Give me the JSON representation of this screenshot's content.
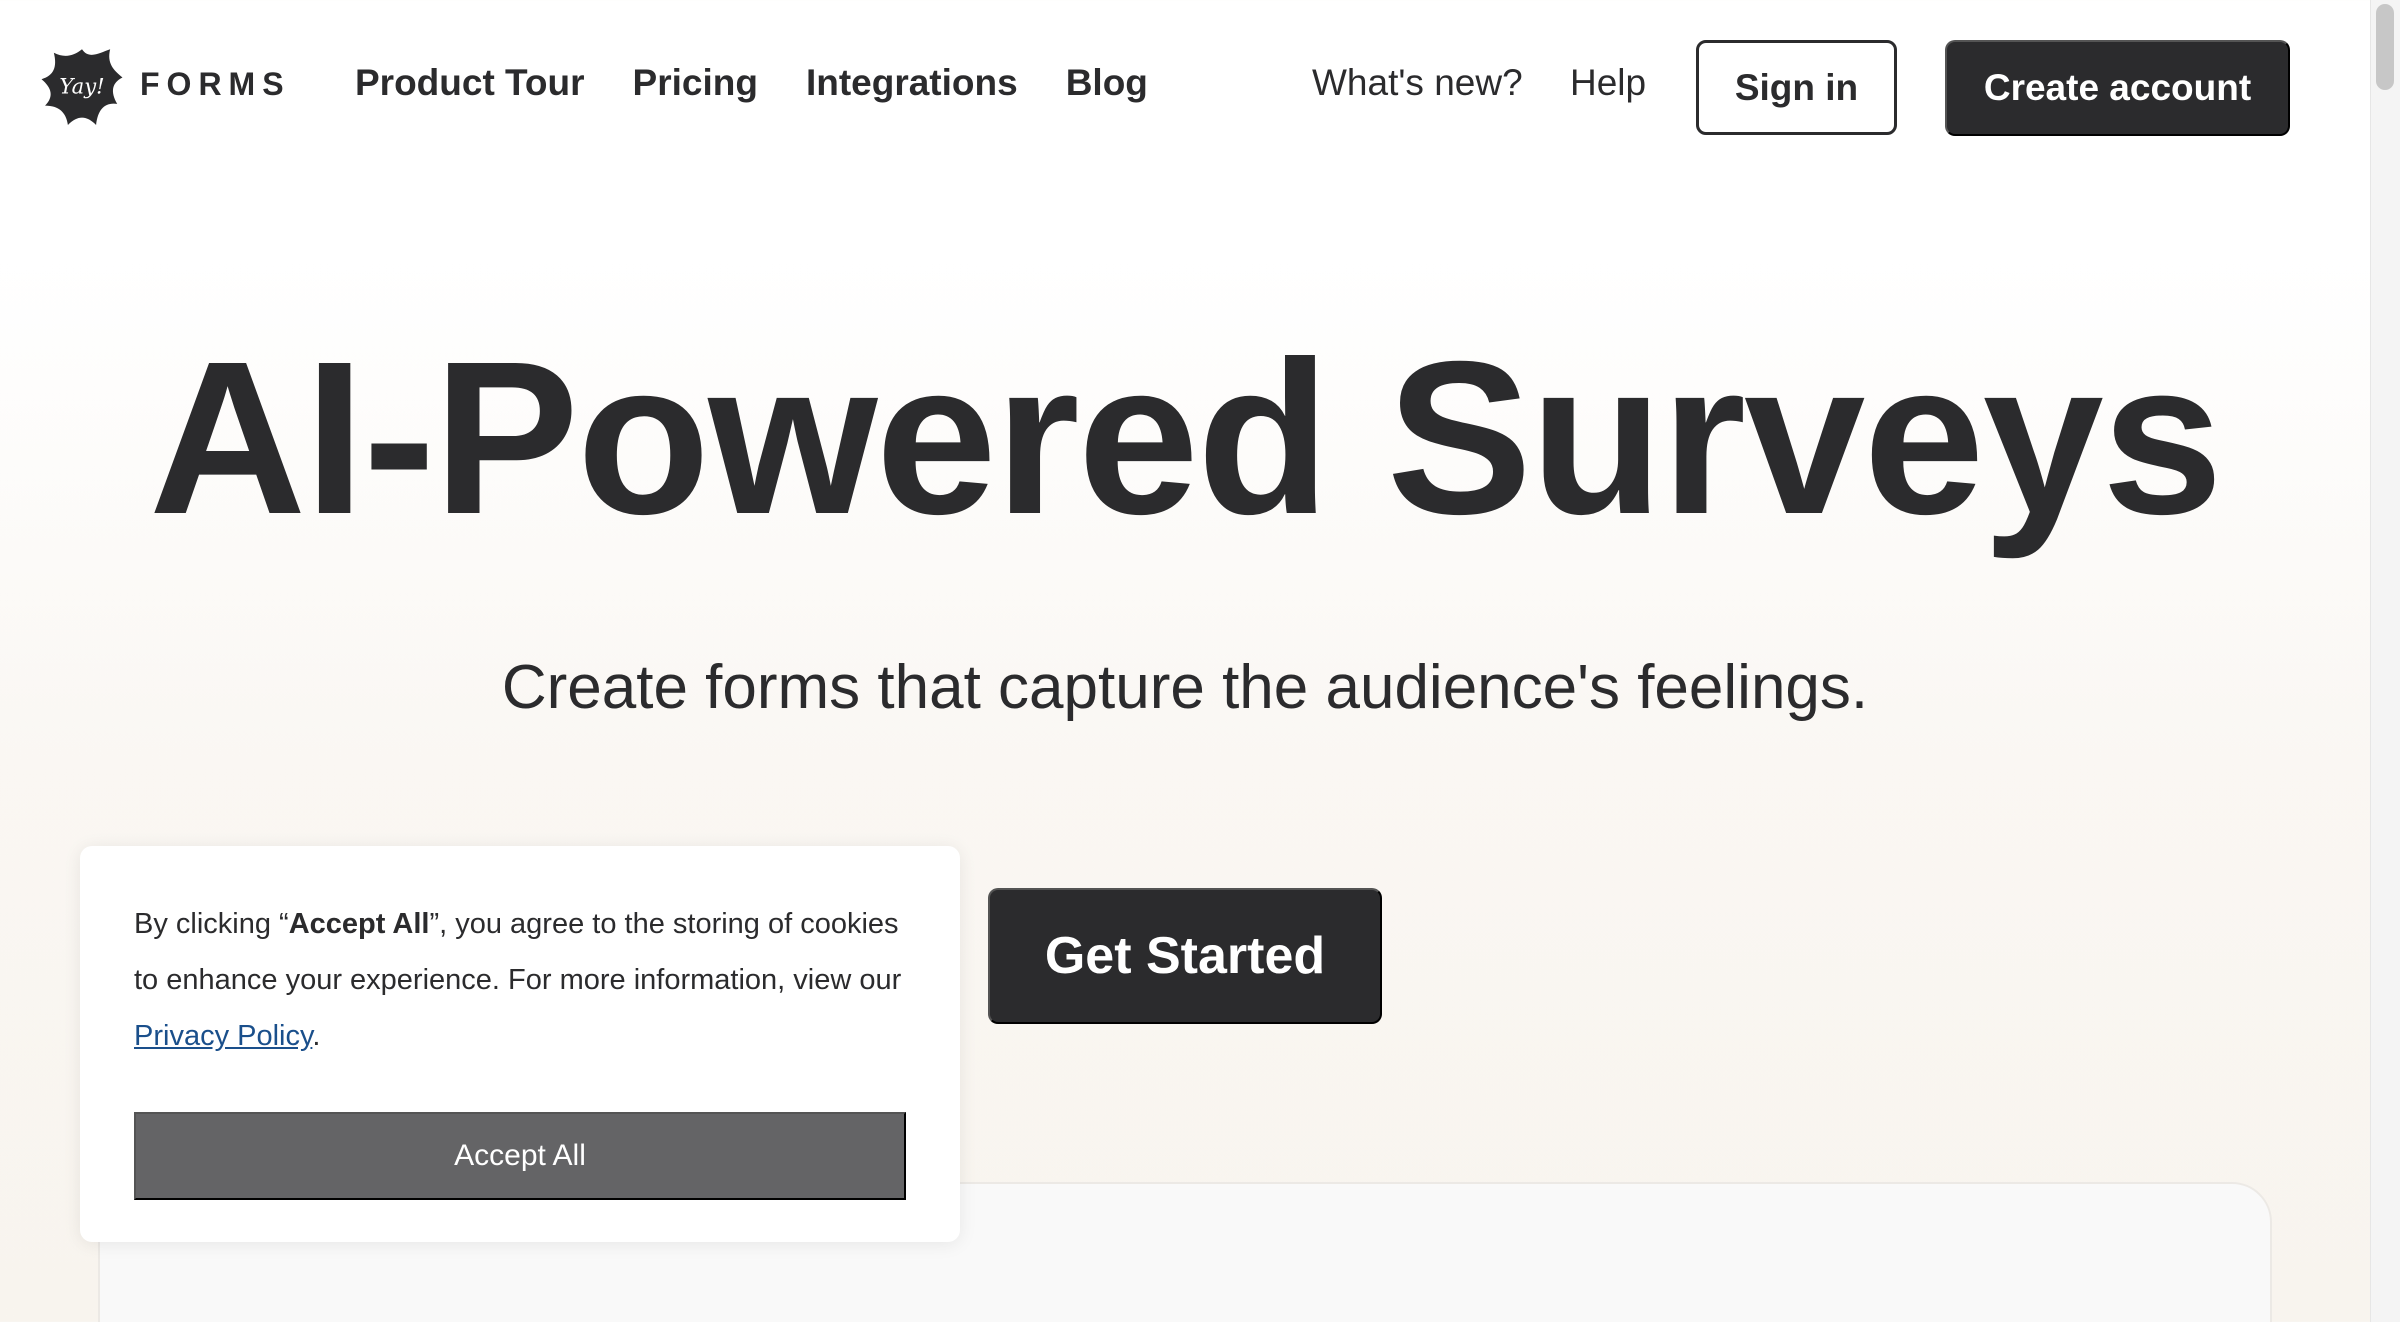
{
  "brand": {
    "logo_script": "Yay!",
    "name": "FORMS"
  },
  "nav": {
    "left": [
      "Product Tour",
      "Pricing",
      "Integrations",
      "Blog"
    ],
    "whats_new": "What's new?",
    "help": "Help",
    "sign_in": "Sign in",
    "create_account": "Create account"
  },
  "hero": {
    "title": "AI-Powered Surveys",
    "subtitle": "Create forms that capture the audience's feelings.",
    "cta": "Get Started"
  },
  "cookie_banner": {
    "text_prefix": "By clicking “",
    "accept_bold": "Accept All",
    "text_middle": "”, you agree to the storing of cookies to enhance your experience. For more information, view our ",
    "privacy_link": "Privacy Policy",
    "text_suffix": ".",
    "accept_button": "Accept All"
  },
  "colors": {
    "text": "#2b2b2d",
    "primary_button": "#2b2b2d",
    "accept_button": "#646466",
    "link": "#1a4f8b",
    "background_warm": "#f8f4ee"
  },
  "icons": {
    "logo": "splat-logo-icon"
  }
}
